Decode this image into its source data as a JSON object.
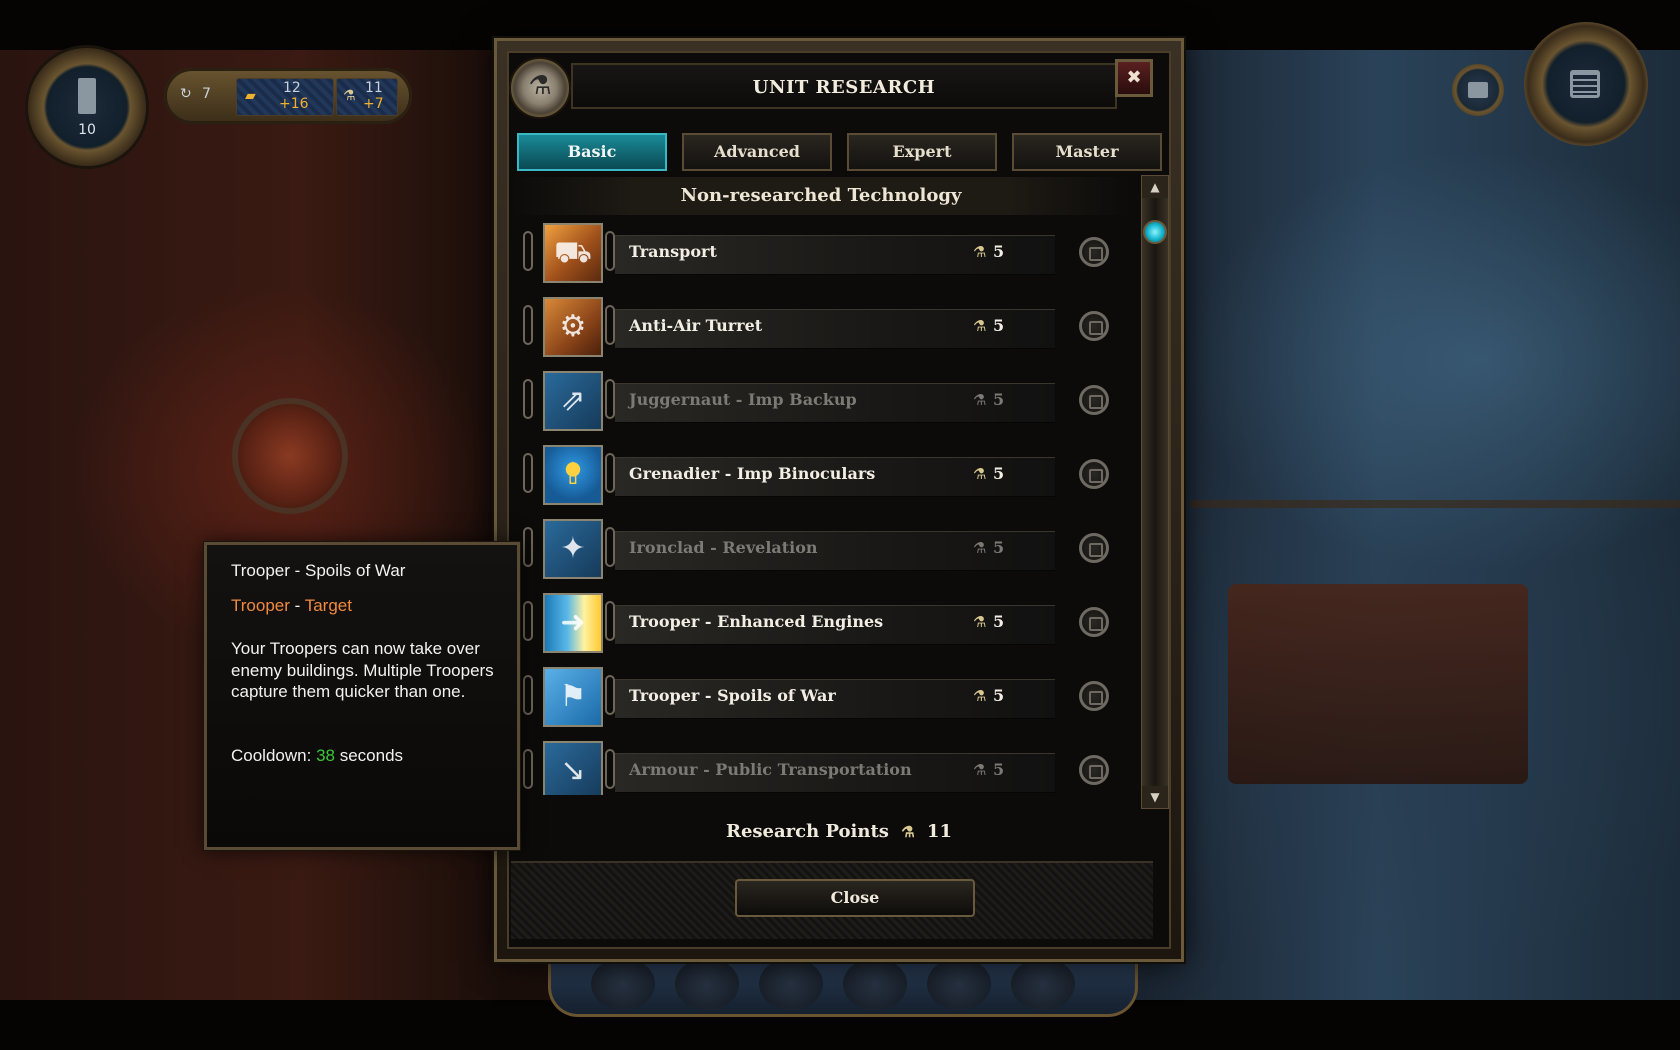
{
  "hud": {
    "cards_count": "10",
    "turn_count": "7",
    "gold_value": "12",
    "gold_income": "+16",
    "research_value": "11",
    "research_income": "+7"
  },
  "dialog": {
    "title": "UNIT RESEARCH",
    "close_glyph": "✖",
    "tabs": [
      {
        "label": "Basic",
        "active": true
      },
      {
        "label": "Advanced",
        "active": false
      },
      {
        "label": "Expert",
        "active": false
      },
      {
        "label": "Master",
        "active": false
      }
    ],
    "section_heading": "Non-researched Technology",
    "items": [
      {
        "name": "Transport",
        "cost": "5",
        "enabled": true,
        "icon": "transport-icon"
      },
      {
        "name": "Anti-Air Turret",
        "cost": "5",
        "enabled": true,
        "icon": "anti-air-turret-icon"
      },
      {
        "name": "Juggernaut - Imp Backup",
        "cost": "5",
        "enabled": false,
        "icon": "imp-backup-icon"
      },
      {
        "name": "Grenadier - Imp Binoculars",
        "cost": "5",
        "enabled": true,
        "icon": "imp-binoculars-icon"
      },
      {
        "name": "Ironclad - Revelation",
        "cost": "5",
        "enabled": false,
        "icon": "revelation-icon"
      },
      {
        "name": "Trooper - Enhanced Engines",
        "cost": "5",
        "enabled": true,
        "icon": "enhanced-engines-icon"
      },
      {
        "name": "Trooper - Spoils of War",
        "cost": "5",
        "enabled": true,
        "icon": "spoils-of-war-icon"
      },
      {
        "name": "Armour - Public Transportation",
        "cost": "5",
        "enabled": false,
        "icon": "public-transportation-icon"
      }
    ],
    "research_points_label": "Research Points",
    "research_points_value": "11",
    "close_button_label": "Close"
  },
  "tooltip": {
    "title": "Trooper - Spoils of War",
    "unit": "Trooper",
    "separator": " - ",
    "ability": "Target",
    "description": "Your Troopers can now take over enemy buildings. Multiple Troopers capture them quicker than one.",
    "cooldown_label": "Cooldown: ",
    "cooldown_value": "38",
    "cooldown_unit": " seconds"
  },
  "colors": {
    "accent_teal": "#1a8a96",
    "tooltip_orange": "#f08a40",
    "cooldown_green": "#3ac83a"
  }
}
